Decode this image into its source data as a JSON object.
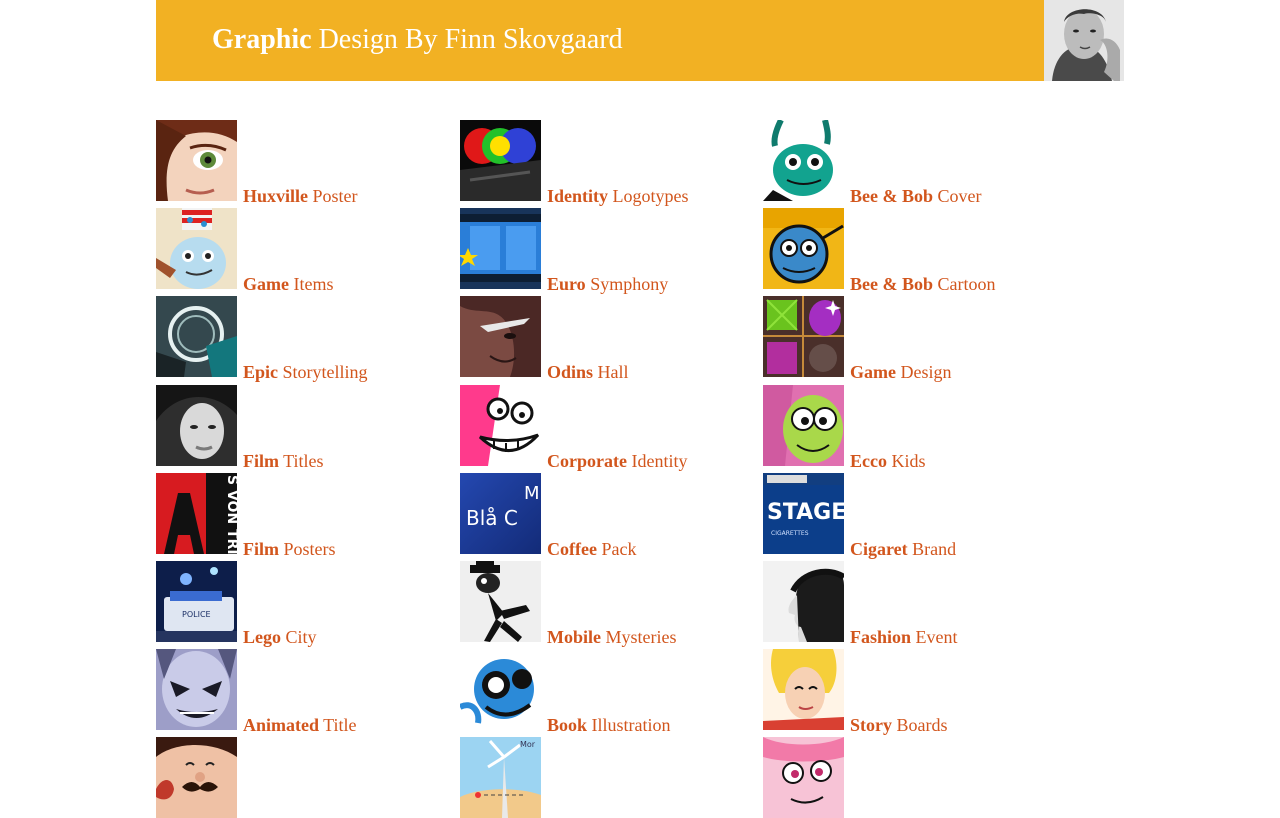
{
  "colors": {
    "accent": "#f2b123",
    "link": "#d2561d"
  },
  "header": {
    "title_bold": "Graphic",
    "title_rest": " Design By Finn Skovgaard"
  },
  "columns": [
    [
      {
        "strong": "Huxville",
        "rest": " Poster",
        "thumb": "girl-face"
      },
      {
        "strong": "Game",
        "rest": " Items",
        "thumb": "snowman"
      },
      {
        "strong": "Epic",
        "rest": " Storytelling",
        "thumb": "round-tech"
      },
      {
        "strong": "Film",
        "rest": " Titles",
        "thumb": "bw-woman"
      },
      {
        "strong": "Film",
        "rest": " Posters",
        "thumb": "red-poster"
      },
      {
        "strong": "Lego",
        "rest": " City",
        "thumb": "police-car"
      },
      {
        "strong": "Animated",
        "rest": " Title",
        "thumb": "villain-face"
      },
      {
        "strong": "",
        "rest": "",
        "thumb": "mustache-man"
      }
    ],
    [
      {
        "strong": "Identity",
        "rest": " Logotypes",
        "thumb": "rgb-circles"
      },
      {
        "strong": "Euro",
        "rest": " Symphony",
        "thumb": "film-strip"
      },
      {
        "strong": "Odins",
        "rest": " Hall",
        "thumb": "odin-face"
      },
      {
        "strong": "Corporate",
        "rest": " Identity",
        "thumb": "pink-grin"
      },
      {
        "strong": "Coffee",
        "rest": " Pack",
        "thumb": "blue-pack"
      },
      {
        "strong": "Mobile",
        "rest": " Mysteries",
        "thumb": "running-figure"
      },
      {
        "strong": "Book",
        "rest": " Illustration",
        "thumb": "blue-creature"
      },
      {
        "strong": "",
        "rest": "",
        "thumb": "windmill"
      }
    ],
    [
      {
        "strong": "Bee & Bob",
        "rest": " Cover",
        "thumb": "green-bug"
      },
      {
        "strong": "Bee & Bob",
        "rest": " Cartoon",
        "thumb": "blue-bug"
      },
      {
        "strong": "Game",
        "rest": " Design",
        "thumb": "gems"
      },
      {
        "strong": "Ecco",
        "rest": " Kids",
        "thumb": "green-alien"
      },
      {
        "strong": "Cigaret",
        "rest": " Brand",
        "thumb": "stage-pack"
      },
      {
        "strong": "Fashion",
        "rest": " Event",
        "thumb": "profile"
      },
      {
        "strong": "Story",
        "rest": " Boards",
        "thumb": "blonde-girl"
      },
      {
        "strong": "",
        "rest": "",
        "thumb": "pink-face"
      }
    ]
  ],
  "thumb_text": {
    "poster_vertical": "S VON TRIER",
    "pack_a": "M",
    "pack_b": "Blå C",
    "stage": "STAGE",
    "stage_sub": "CIGARETTES",
    "police": "POLICE",
    "windmill_corner": "Mor"
  }
}
